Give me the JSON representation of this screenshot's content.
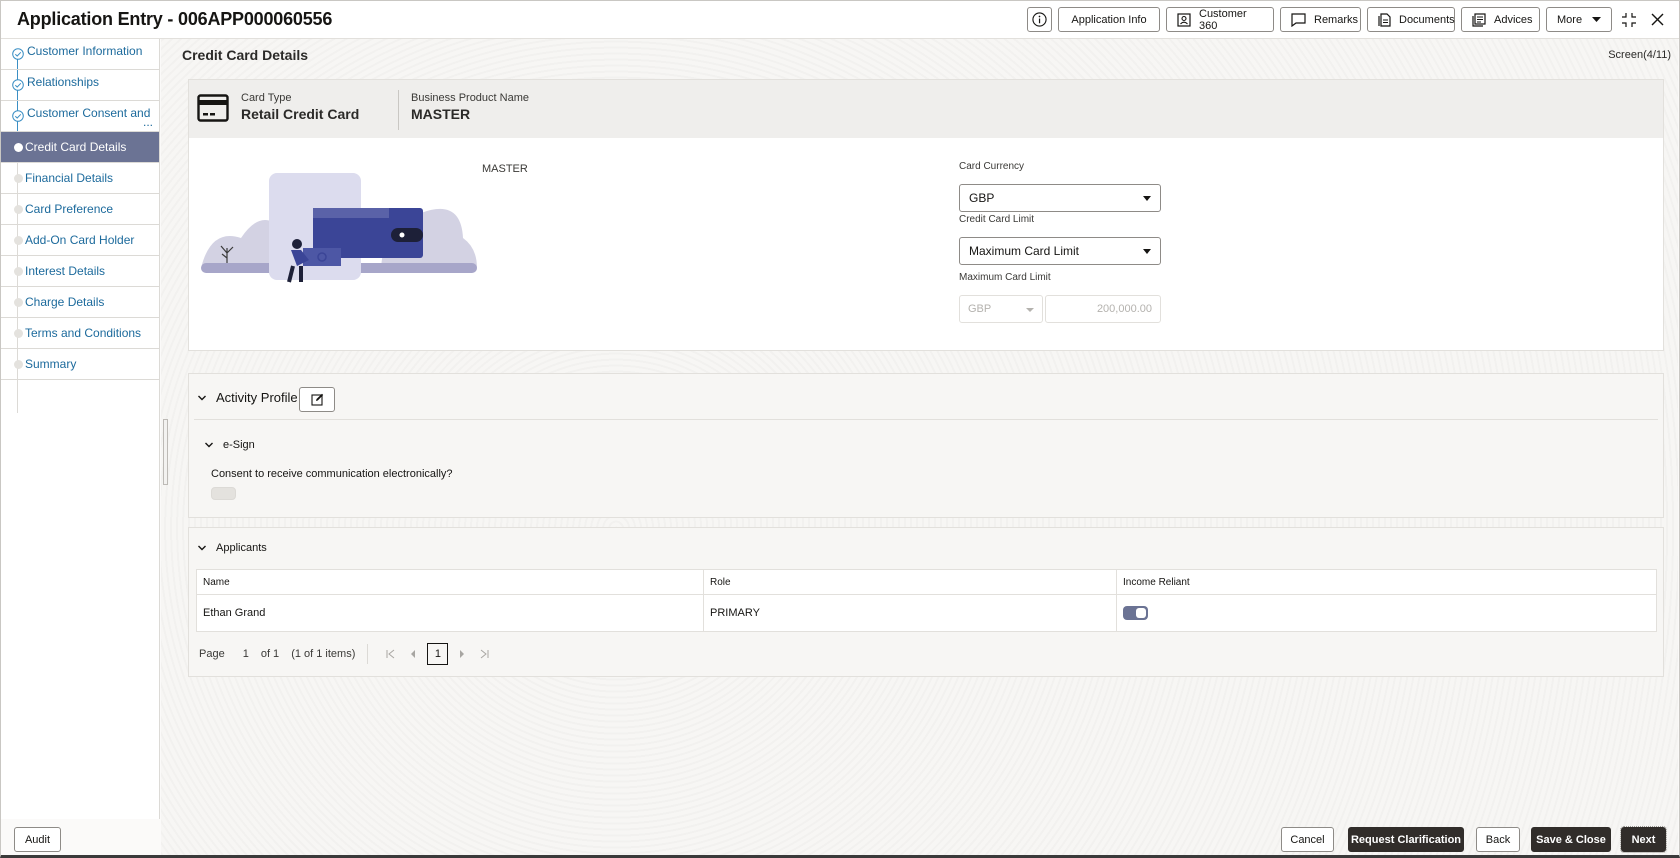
{
  "header": {
    "title": "Application Entry - 006APP000060556",
    "buttons": [
      {
        "id": "info",
        "label": "",
        "icon": "info-icon"
      },
      {
        "id": "application-info",
        "label": "Application Info"
      },
      {
        "id": "customer-360",
        "label": "Customer 360",
        "icon": "user-card-icon"
      },
      {
        "id": "remarks",
        "label": "Remarks",
        "icon": "comment-icon"
      },
      {
        "id": "documents",
        "label": "Documents",
        "icon": "document-icon"
      },
      {
        "id": "advices",
        "label": "Advices",
        "icon": "advices-icon"
      },
      {
        "id": "more",
        "label": "More",
        "icon": "caret-down-icon"
      }
    ],
    "window_icons": [
      "collapse-icon",
      "close-icon"
    ]
  },
  "sidebar": {
    "items": [
      {
        "label": "Customer Information",
        "state": "completed"
      },
      {
        "label": "Relationships",
        "state": "completed"
      },
      {
        "label": "Customer Consent and",
        "state": "completed",
        "truncated": true,
        "ellipsis": "..."
      },
      {
        "label": "Credit Card Details",
        "state": "active"
      },
      {
        "label": "Financial Details",
        "state": "pending"
      },
      {
        "label": "Card Preference",
        "state": "pending"
      },
      {
        "label": "Add-On Card Holder",
        "state": "pending"
      },
      {
        "label": "Interest Details",
        "state": "pending"
      },
      {
        "label": "Charge Details",
        "state": "pending"
      },
      {
        "label": "Terms and Conditions",
        "state": "pending"
      },
      {
        "label": "Summary",
        "state": "pending"
      }
    ]
  },
  "main": {
    "title": "Credit Card Details",
    "screen_indicator": "Screen(4/11)",
    "card_header": {
      "card_type_label": "Card Type",
      "card_type_value": "Retail Credit Card",
      "product_label": "Business Product Name",
      "product_value": "MASTER"
    },
    "product_caption": "MASTER",
    "fields": {
      "card_currency": {
        "label": "Card Currency",
        "value": "GBP"
      },
      "credit_card_limit": {
        "label": "Credit Card Limit",
        "value": "Maximum Card Limit"
      },
      "maximum_card_limit": {
        "label": "Maximum Card Limit",
        "currency": "GBP",
        "amount": "200,000.00",
        "disabled": true
      }
    },
    "activity_profile": {
      "title": "Activity Profile",
      "esign": {
        "title": "e-Sign",
        "question": "Consent to receive communication electronically?",
        "toggle_on": false
      }
    },
    "applicants": {
      "title": "Applicants",
      "columns": [
        "Name",
        "Role",
        "Income Reliant"
      ],
      "rows": [
        {
          "name": "Ethan Grand",
          "role": "PRIMARY",
          "income_reliant": true
        }
      ],
      "pagination": {
        "page_label": "Page",
        "page": "1",
        "of_label": "of 1",
        "items_label": "(1 of 1 items)",
        "current_page_button": "1"
      }
    }
  },
  "footer": {
    "audit": "Audit",
    "cancel": "Cancel",
    "request_clarification": "Request Clarification",
    "back": "Back",
    "save_close": "Save & Close",
    "next": "Next"
  },
  "colors": {
    "accent": "#6b7394",
    "link": "#1c6a9c",
    "primary_button": "#312d2a"
  }
}
